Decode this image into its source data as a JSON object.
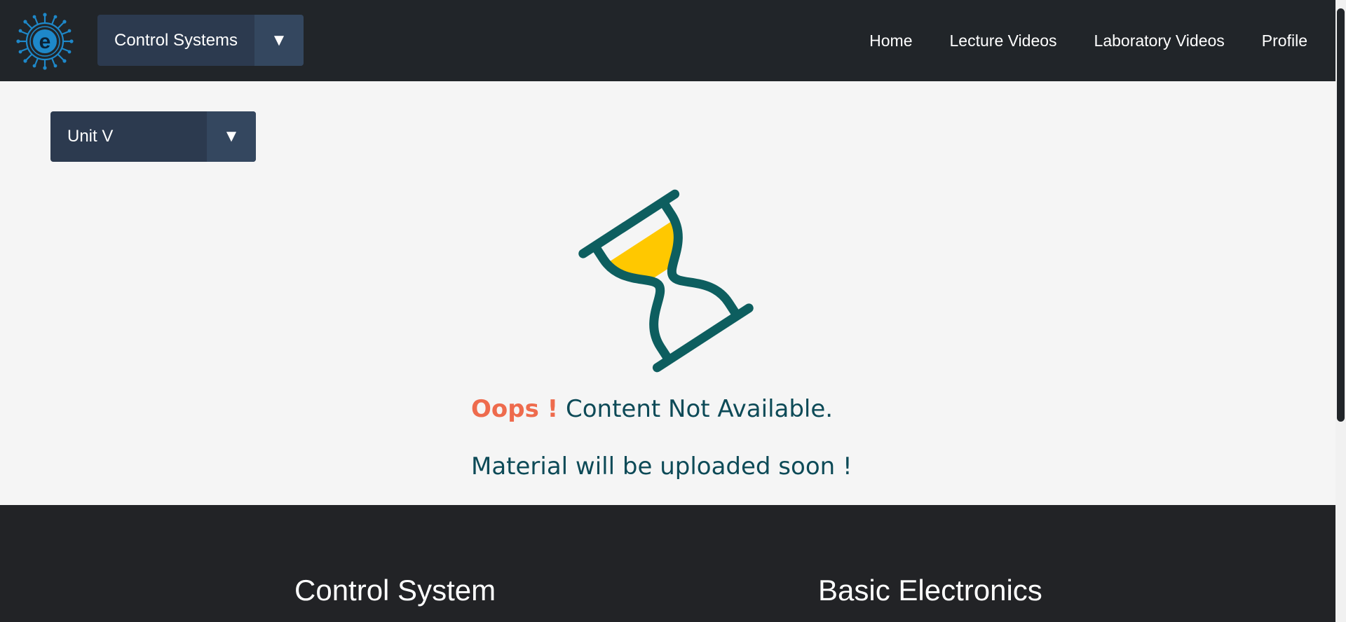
{
  "navbar": {
    "subject_select": {
      "value": "Control Systems",
      "arrow": "▼"
    },
    "links": [
      "Home",
      "Lecture Videos",
      "Laboratory Videos",
      "Profile"
    ]
  },
  "main": {
    "unit_select": {
      "value": "Unit V",
      "arrow": "▼"
    },
    "message": {
      "oops": "Oops !",
      "text": "Content Not Available.",
      "subtext": "Material will be uploaded soon !"
    }
  },
  "footer": {
    "left_heading": "Control System",
    "right_heading": "Basic Electronics"
  },
  "colors": {
    "navbar_bg": "#212529",
    "accent_teal": "#0d5e5f",
    "sand_yellow": "#ffc800",
    "oops_red": "#ee6b4d",
    "text_dark_teal": "#0d4a57"
  },
  "icons": {
    "logo": "e-circuit-logo-icon",
    "hourglass": "hourglass-icon",
    "dropdown": "caret-down-icon"
  }
}
